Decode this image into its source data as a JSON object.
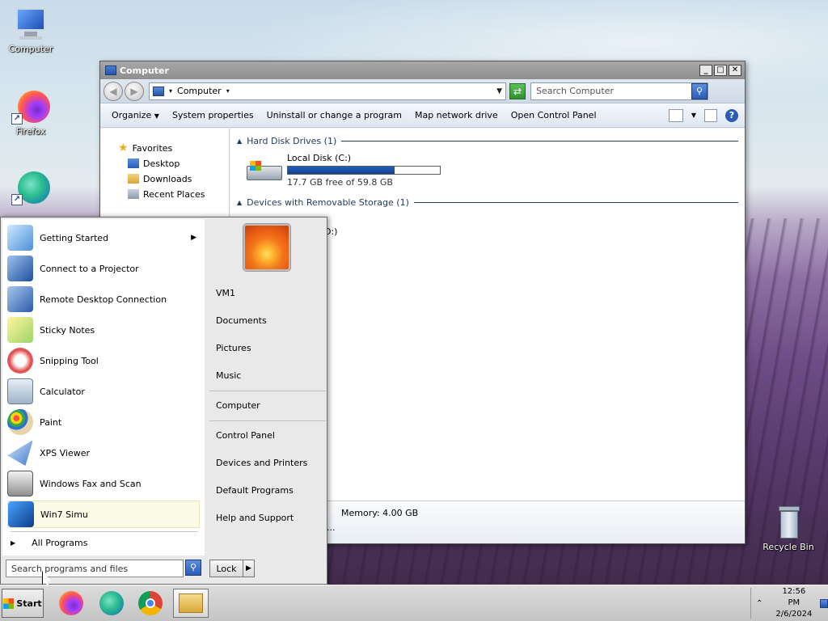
{
  "desktop": {
    "icons": {
      "computer": "Computer",
      "firefox": "Firefox",
      "recycle": "Recycle Bin"
    }
  },
  "explorer": {
    "title": "Computer",
    "address": "Computer",
    "search_placeholder": "Search Computer",
    "commands": {
      "organize": "Organize",
      "system_properties": "System properties",
      "uninstall": "Uninstall or change a program",
      "map_drive": "Map network drive",
      "control_panel": "Open Control Panel"
    },
    "nav": {
      "favorites": "Favorites",
      "desktop": "Desktop",
      "downloads": "Downloads",
      "recent": "Recent Places"
    },
    "groups": {
      "hdd": "Hard Disk Drives (1)",
      "removable": "Devices with Removable Storage (1)"
    },
    "drive": {
      "name": "Local Disk (C:)",
      "space": "17.7 GB free of 59.8 GB",
      "used_fraction": 0.704
    },
    "partial_removable": "D:)",
    "details": {
      "memory": "Memory: 4.00 GB",
      "more": "..."
    }
  },
  "startmenu": {
    "programs": [
      {
        "label": "Getting Started"
      },
      {
        "label": "Connect to a Projector"
      },
      {
        "label": "Remote Desktop Connection"
      },
      {
        "label": "Sticky Notes"
      },
      {
        "label": "Snipping Tool"
      },
      {
        "label": "Calculator"
      },
      {
        "label": "Paint"
      },
      {
        "label": "XPS Viewer"
      },
      {
        "label": "Windows Fax and Scan"
      },
      {
        "label": "Win7 Simu"
      }
    ],
    "all_programs": "All Programs",
    "search_placeholder": "Search programs and files",
    "right": {
      "user": "VM1",
      "documents": "Documents",
      "pictures": "Pictures",
      "music": "Music",
      "computer": "Computer",
      "control_panel": "Control Panel",
      "devices": "Devices and Printers",
      "default_programs": "Default Programs",
      "help": "Help and Support"
    },
    "lock": "Lock"
  },
  "taskbar": {
    "start": "Start",
    "time": "12:56 PM",
    "date": "2/6/2024"
  }
}
